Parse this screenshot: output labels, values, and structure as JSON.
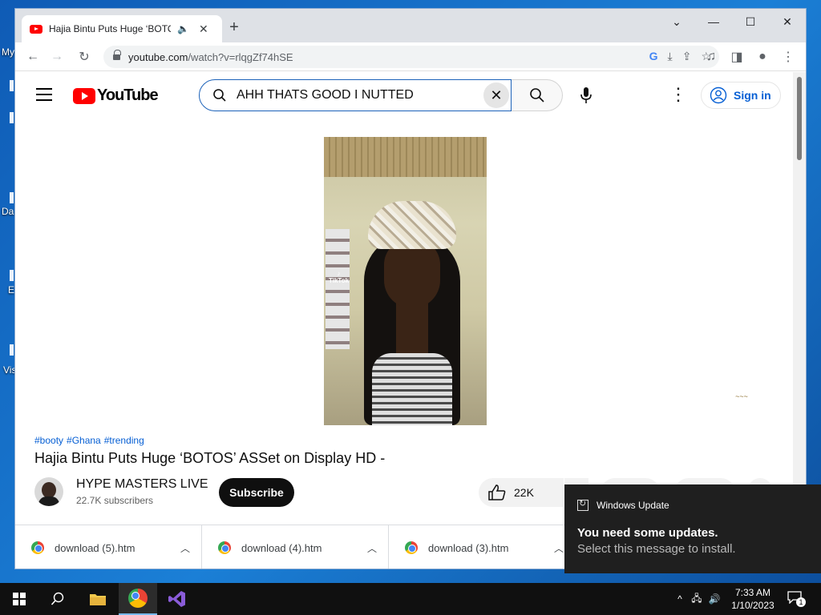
{
  "desktop": {
    "labels": [
      "My",
      "Da",
      "E",
      "Vis"
    ]
  },
  "browser": {
    "tab_title": "Hajia Bintu Puts Huge ‘BOTOS’ ASSet on Display HD -",
    "url_host": "youtube.com",
    "url_path": "/watch?v=rlqgZf74hSE",
    "window_controls": [
      "minimize",
      "maximize",
      "close"
    ]
  },
  "youtube": {
    "logo_text": "YouTube",
    "search_value": "AHH THATS GOOD I NUTTED",
    "signin_label": "Sign in",
    "video_overlay": "TikTok",
    "tags": [
      "#booty",
      "#Ghana",
      "#trending"
    ],
    "video_title": "Hajia Bintu Puts Huge ‘BOTOS’ ASSet on Display HD -",
    "channel_name": "HYPE MASTERS LIVE",
    "subscribers": "22.7K subscribers",
    "subscribe_label": "Subscribe",
    "like_count": "22K"
  },
  "downloads": [
    {
      "name": "download (5).htm"
    },
    {
      "name": "download (4).htm"
    },
    {
      "name": "download (3).htm"
    }
  ],
  "notification": {
    "source": "Windows Update",
    "title": "You need some updates.",
    "message": "Select this message to install."
  },
  "taskbar": {
    "time": "7:33 AM",
    "date": "1/10/2023",
    "notification_count": "1"
  },
  "colors": {
    "yt_red": "#ff0000",
    "link_blue": "#065fd4",
    "taskbar": "#101010"
  }
}
